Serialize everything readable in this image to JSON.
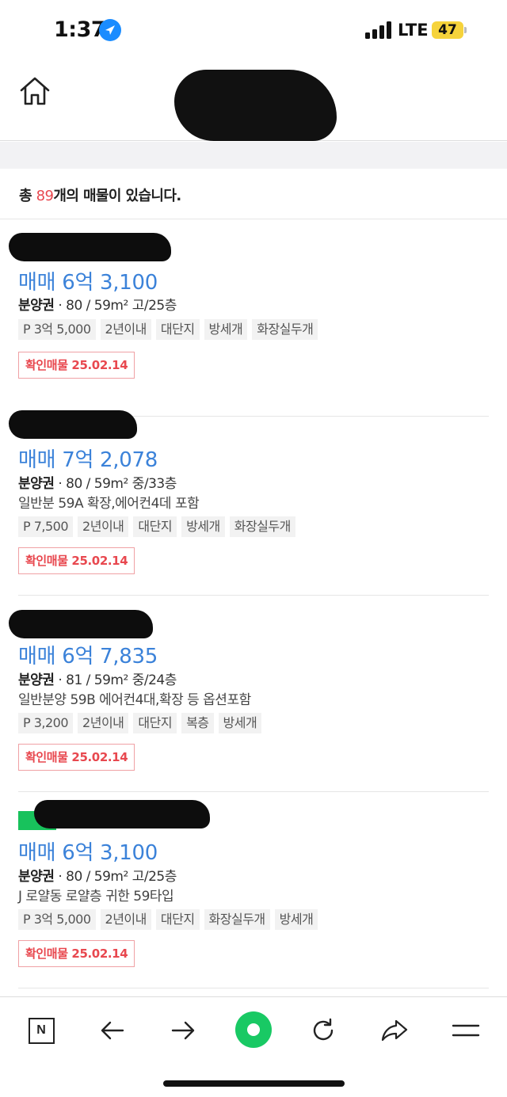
{
  "status": {
    "time": "1:37",
    "network": "LTE",
    "battery": "47"
  },
  "header": {
    "home_icon": "home-icon"
  },
  "summary": {
    "prefix": "총",
    "count": "89",
    "suffix": "개의 매물이 있습니다."
  },
  "listings": [
    {
      "price": "매매 6억 3,100",
      "type": "분양권",
      "spec": " · 80 / 59m² 고/25층",
      "desc": "",
      "tags": [
        "P 3억 5,000",
        "2년이내",
        "대단지",
        "방세개",
        "화장실두개"
      ],
      "verify": "확인매물 25.02.14"
    },
    {
      "price": "매매 7억 2,078",
      "type": "분양권",
      "spec": " · 80 / 59m² 중/33층",
      "desc": "일반분 59A 확장,에어컨4데 포함",
      "tags": [
        "P 7,500",
        "2년이내",
        "대단지",
        "방세개",
        "화장실두개"
      ],
      "verify": "확인매물 25.02.14"
    },
    {
      "price": "매매 6억 7,835",
      "type": "분양권",
      "spec": " · 81 / 59m² 중/24층",
      "desc": "일반분양 59B 에어컨4대,확장 등 옵션포함",
      "tags": [
        "P 3,200",
        "2년이내",
        "대단지",
        "복층",
        "방세개"
      ],
      "verify": "확인매물 25.02.14"
    },
    {
      "price": "매매 6억 3,100",
      "type": "분양권",
      "spec": " · 80 / 59m² 고/25층",
      "desc": "J 로얄동 로얄층 귀한 59타입",
      "tags": [
        "P 3억 5,000",
        "2년이내",
        "대단지",
        "화장실두개",
        "방세개"
      ],
      "verify": "확인매물 25.02.14"
    }
  ],
  "bottom_nav": {
    "n_label": "N",
    "icons": [
      "naver-n-icon",
      "back-arrow-icon",
      "forward-arrow-icon",
      "green-dot-icon",
      "refresh-icon",
      "share-icon",
      "menu-icon"
    ]
  },
  "colors": {
    "price": "#3b82d9",
    "accent_red": "#e8484f",
    "green": "#19c964"
  }
}
